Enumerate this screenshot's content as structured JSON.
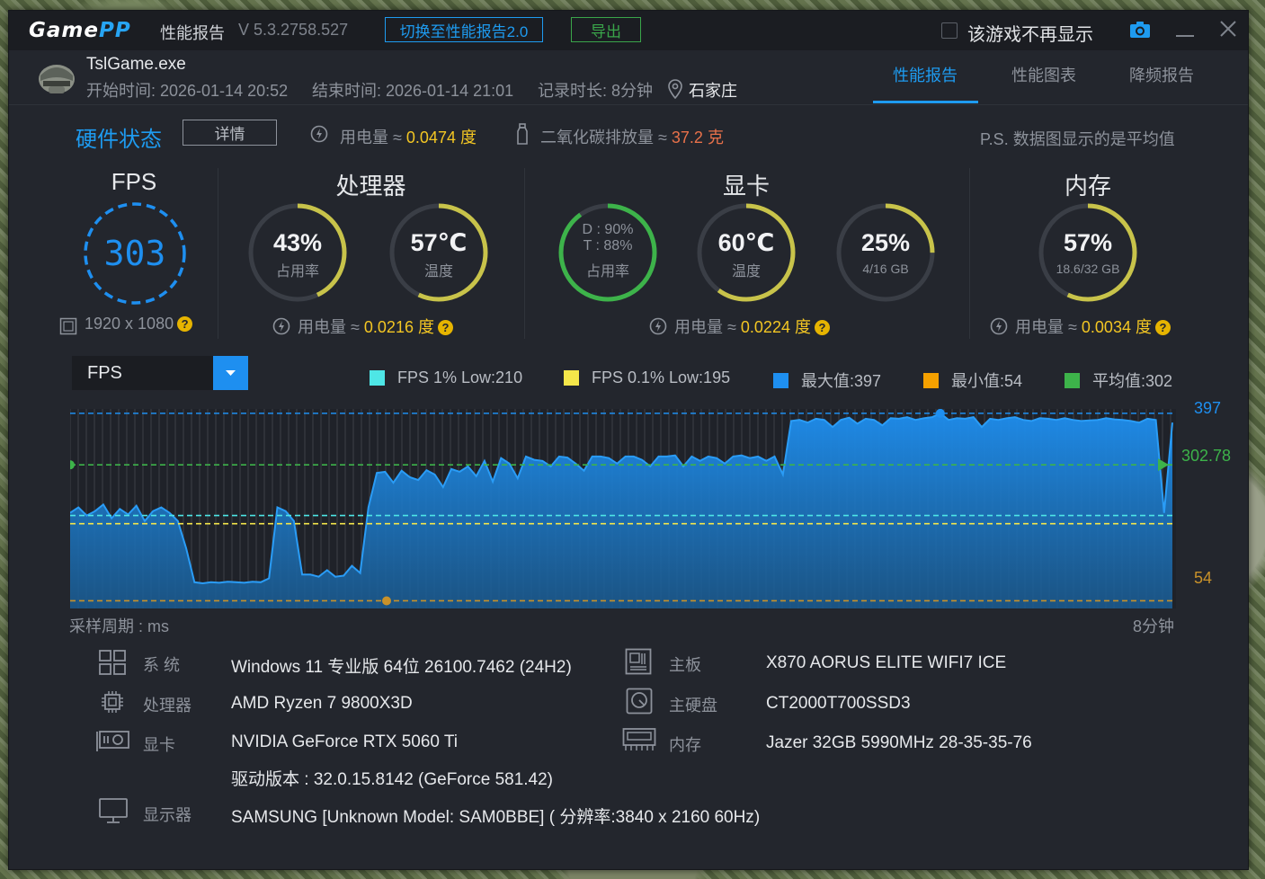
{
  "title_bar": {
    "logo_game": "Game",
    "logo_pp": "PP",
    "report_title": "性能报告",
    "version": "V 5.3.2758.527",
    "switch_button": "切换至性能报告2.0",
    "export_button": "导出",
    "hide_checkbox_label": "该游戏不再显示"
  },
  "session": {
    "exe": "TslGame.exe",
    "start": "开始时间: 2026-01-14 20:52",
    "end": "结束时间: 2026-01-14 21:01",
    "duration": "记录时长: 8分钟",
    "location": "石家庄"
  },
  "tabs": [
    {
      "label": "性能报告",
      "active": true
    },
    {
      "label": "性能图表",
      "active": false
    },
    {
      "label": "降频报告",
      "active": false
    }
  ],
  "hardware": {
    "title": "硬件状态",
    "detail_button": "详情",
    "power_label": "用电量 ≈",
    "power_value": "0.0474 度",
    "co2_label": "二氧化碳排放量 ≈",
    "co2_value": "37.2 克",
    "note": "P.S. 数据图显示的是平均值"
  },
  "gauges": {
    "fps": {
      "title": "FPS",
      "value": "303",
      "resolution": "1920 x 1080"
    },
    "cpu": {
      "title": "处理器",
      "usage_value": "43%",
      "usage_label": "占用率",
      "usage_fraction": 0.43,
      "temp_value": "57℃",
      "temp_label": "温度",
      "temp_fraction": 0.57,
      "power_label": "用电量 ≈",
      "power_value": "0.0216 度"
    },
    "gpu": {
      "title": "显卡",
      "usage_d": "D : 90%",
      "usage_t": "T : 88%",
      "usage_label": "占用率",
      "usage_fraction": 0.9,
      "temp_value": "60℃",
      "temp_label": "温度",
      "temp_fraction": 0.6,
      "vram_value": "25%",
      "vram_sub": "4/16 GB",
      "vram_fraction": 0.25,
      "power_label": "用电量 ≈",
      "power_value": "0.0224 度"
    },
    "memory": {
      "title": "内存",
      "value": "57%",
      "sub": "18.6/32 GB",
      "fraction": 0.57,
      "power_label": "用电量 ≈",
      "power_value": "0.0034 度"
    }
  },
  "metric_select": {
    "selected": "FPS"
  },
  "legend": [
    {
      "label": "FPS 1% Low:210",
      "color": "#4ee6e6"
    },
    {
      "label": "FPS 0.1% Low:195",
      "color": "#f5e74a"
    },
    {
      "label": "最大值:397",
      "color": "#1e8ff0"
    },
    {
      "label": "最小值:54",
      "color": "#f5a100"
    },
    {
      "label": "平均值:302",
      "color": "#3db34a"
    }
  ],
  "chart_data": {
    "type": "area",
    "ylim": [
      40,
      405
    ],
    "max": 397,
    "min": 54,
    "avg": 302.78,
    "low_1pct": 210,
    "low_01pct": 195,
    "labels": {
      "max": "397",
      "avg": "302.78",
      "min": "54"
    },
    "x_left_label": "采样周期 : ms",
    "x_right_label": "8分钟",
    "values": [
      215,
      225,
      210,
      218,
      230,
      205,
      222,
      212,
      228,
      200,
      218,
      225,
      215,
      200,
      150,
      88,
      86,
      88,
      87,
      89,
      88,
      87,
      89,
      88,
      95,
      225,
      218,
      200,
      102,
      102,
      98,
      110,
      98,
      100,
      118,
      105,
      225,
      288,
      290,
      270,
      292,
      280,
      275,
      293,
      285,
      262,
      295,
      290,
      300,
      282,
      310,
      272,
      315,
      305,
      278,
      318,
      312,
      310,
      300,
      318,
      316,
      305,
      292,
      318,
      318,
      315,
      305,
      318,
      318,
      312,
      300,
      318,
      318,
      320,
      300,
      318,
      310,
      318,
      315,
      305,
      318,
      320,
      315,
      318,
      310,
      318,
      285,
      383,
      385,
      380,
      387,
      385,
      372,
      385,
      389,
      378,
      387,
      385,
      375,
      388,
      387,
      390,
      385,
      388,
      390,
      397,
      385,
      388,
      387,
      390,
      372,
      387,
      385,
      388,
      390,
      385,
      383,
      388,
      387,
      385,
      388,
      385,
      383,
      384,
      385,
      388,
      386,
      385,
      383,
      380,
      387,
      385,
      215,
      380
    ],
    "grid": true
  },
  "system_info": {
    "os_label": "系  统",
    "os_value": "Windows 11 专业版 64位 26100.7462 (24H2)",
    "cpu_label": "处理器",
    "cpu_value": "AMD Ryzen 7 9800X3D",
    "gpu_label": "显卡",
    "gpu_value": "NVIDIA GeForce RTX 5060 Ti",
    "driver_value": "驱动版本 : 32.0.15.8142 (GeForce 581.42)",
    "monitor_label": "显示器",
    "monitor_value": "SAMSUNG [Unknown Model: SAM0BBE] ( 分辨率:3840 x 2160 60Hz)",
    "board_label": "主板",
    "board_value": "X870 AORUS ELITE WIFI7 ICE",
    "disk_label": "主硬盘",
    "disk_value": "CT2000T700SSD3",
    "mem_label": "内存",
    "mem_value": "Jazer 32GB 5990MHz 28-35-35-76"
  }
}
